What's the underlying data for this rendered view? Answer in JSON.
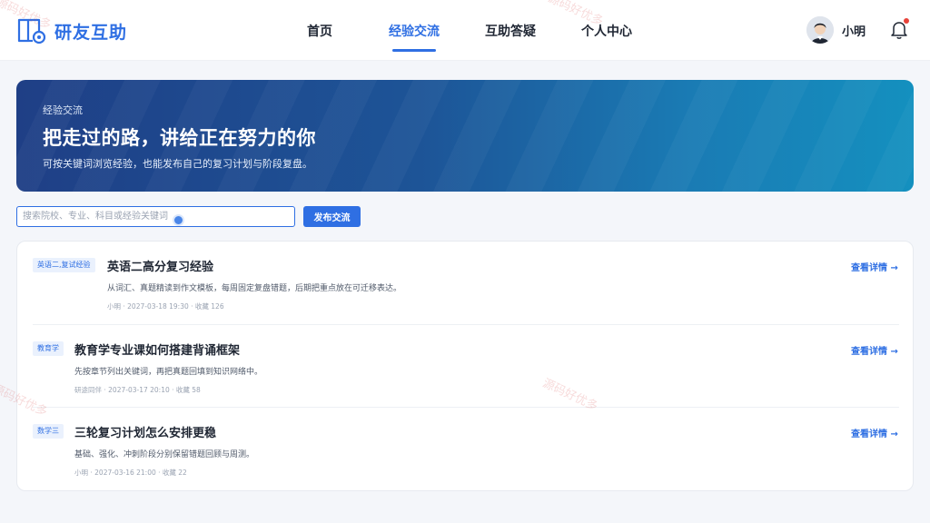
{
  "app": {
    "name": "研友互助"
  },
  "nav": {
    "items": [
      {
        "label": "首页"
      },
      {
        "label": "经验交流",
        "active": true
      },
      {
        "label": "互助答疑"
      },
      {
        "label": "个人中心"
      }
    ]
  },
  "user": {
    "name": "小明"
  },
  "banner": {
    "eyebrow": "经验交流",
    "title": "把走过的路，讲给正在努力的你",
    "subtitle": "可按关键词浏览经验，也能发布自己的复习计划与阶段复盘。"
  },
  "search": {
    "placeholder": "搜索院校、专业、科目或经验关键词",
    "value": ""
  },
  "publish_button": {
    "label": "发布交流"
  },
  "posts": [
    {
      "tag": "英语二,复试经验",
      "title": "英语二高分复习经验",
      "desc": "从词汇、真题精读到作文模板，每周固定复盘错题，后期把重点放在可迁移表达。",
      "meta": "小明 · 2027-03-18 19:30 · 收藏 126",
      "link": "查看详情 →"
    },
    {
      "tag": "教育学",
      "title": "教育学专业课如何搭建背诵框架",
      "desc": "先按章节列出关键词，再把真题回填到知识网络中。",
      "meta": "研途同伴 · 2027-03-17 20:10 · 收藏 58",
      "link": "查看详情 →"
    },
    {
      "tag": "数学三",
      "title": "三轮复习计划怎么安排更稳",
      "desc": "基础、强化、冲刺阶段分别保留错题回顾与周测。",
      "meta": "小明 · 2027-03-16 21:00 · 收藏 22",
      "link": "查看详情 →"
    }
  ],
  "watermark": {
    "text": "源码好优多"
  },
  "colors": {
    "accent": "#2f6fe3",
    "banner_start": "#1f3f86",
    "banner_end": "#1490bf",
    "notify_dot": "#e8433a"
  }
}
